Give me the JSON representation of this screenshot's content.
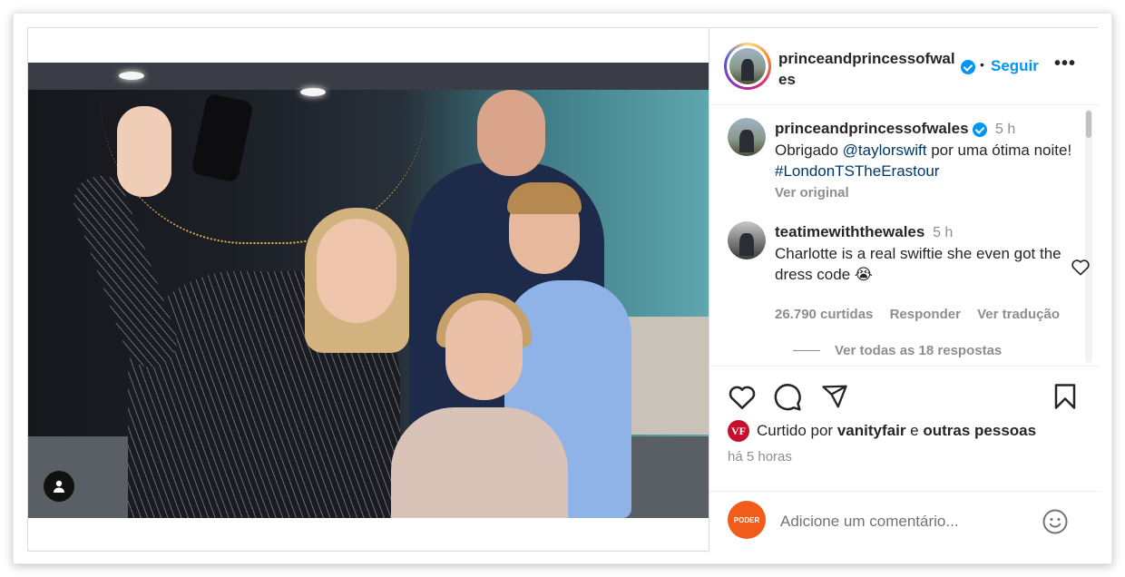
{
  "post": {
    "author": "princeandprincessofwales",
    "header_author_wrapped": "princeandprincessofwales",
    "follow_label": "Seguir",
    "separator": "•",
    "more_label": "•••"
  },
  "caption": {
    "author": "princeandprincessofwales",
    "time": "5 h",
    "text_before": "Obrigado ",
    "mention": "@taylorswift",
    "text_after": " por uma ótima noite! ",
    "hashtag": "#LondonTSTheErastour",
    "see_original": "Ver original"
  },
  "comment": {
    "author": "teatimewiththewales",
    "time": "5 h",
    "text": "Charlotte is a real swiftie she even got the dress code 😭",
    "likes": "26.790 curtidas",
    "reply_label": "Responder",
    "translate_label": "Ver tradução",
    "view_replies": "Ver todas as 18 respostas"
  },
  "likes": {
    "prefix": "Curtido por ",
    "user": "vanityfair",
    "connector": " e ",
    "others": "outras pessoas",
    "badge": "VF"
  },
  "time_ago": "há 5 horas",
  "add_comment": {
    "placeholder": "Adicione um comentário...",
    "avatar_label": "PODER"
  },
  "icons": {
    "like": "heart-icon",
    "comment": "comment-icon",
    "share": "paper-plane-icon",
    "save": "bookmark-icon",
    "emoji": "smiley-icon",
    "verified": "verified-badge-icon",
    "user_tag": "user-tag-icon"
  },
  "colors": {
    "accent": "#0095f6",
    "text": "#262626",
    "muted": "#8e8e8e",
    "link": "#00376b",
    "vf_badge": "#c8102e",
    "poder_avatar": "#f25c1b"
  }
}
